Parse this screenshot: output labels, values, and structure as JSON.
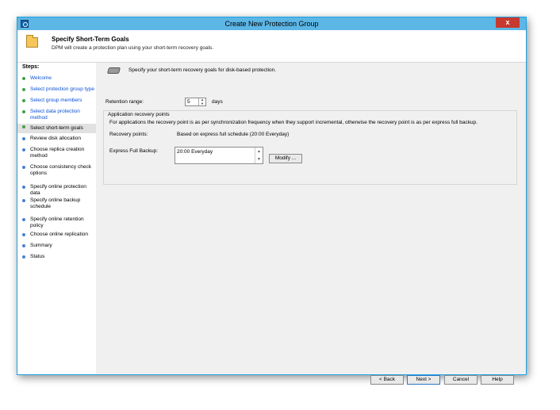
{
  "window": {
    "title": "Create New Protection Group",
    "close_label": "x"
  },
  "header": {
    "title": "Specify Short-Term Goals",
    "subtitle": "DPM will create a protection plan using your short-term recovery goals."
  },
  "steps": {
    "title": "Steps:",
    "items": [
      {
        "label": "Welcome",
        "state": "done"
      },
      {
        "label": "Select protection group type",
        "state": "done"
      },
      {
        "label": "Select group members",
        "state": "done"
      },
      {
        "label": "Select data protection method",
        "state": "done"
      },
      {
        "label": "Select short-term goals",
        "state": "current"
      },
      {
        "label": "Review disk allocation",
        "state": "pending"
      },
      {
        "label": "Choose replica creation method",
        "state": "pending"
      },
      {
        "label": "Choose consistency check options",
        "state": "pending"
      },
      {
        "label": "Specify online protection data",
        "state": "pending"
      },
      {
        "label": "Specify online backup schedule",
        "state": "pending"
      },
      {
        "label": "Specify online retention policy",
        "state": "pending"
      },
      {
        "label": "Choose online replication",
        "state": "pending"
      },
      {
        "label": "Summary",
        "state": "pending"
      },
      {
        "label": "Status",
        "state": "pending"
      }
    ]
  },
  "main": {
    "intro": "Specify your short-term recovery goals for disk-based protection.",
    "retention_label": "Retention range:",
    "retention_value": "5",
    "retention_unit": "days",
    "group_title": "Application recovery points",
    "group_desc": "For applications the recovery point is as per synchronization frequency when they support incremental, otherwise the recovery point is as per express full backup.",
    "recovery_points_label": "Recovery points:",
    "recovery_points_value": "Based on express full schedule (20:00 Everyday)",
    "express_label": "Express Full Backup:",
    "express_item": "20:00 Everyday",
    "modify_button": "Modify ..."
  },
  "footer": {
    "back": "< Back",
    "next": "Next >",
    "cancel": "Cancel",
    "help": "Help"
  },
  "colors": {
    "titlebar": "#5cb6e6",
    "close": "#c7392e",
    "link": "#0b4fd6",
    "done_dot": "#43a047",
    "pending_dot": "#4a7fd0"
  },
  "icons": [
    "app-icon",
    "folder-icon",
    "disk-icon",
    "close-icon"
  ]
}
